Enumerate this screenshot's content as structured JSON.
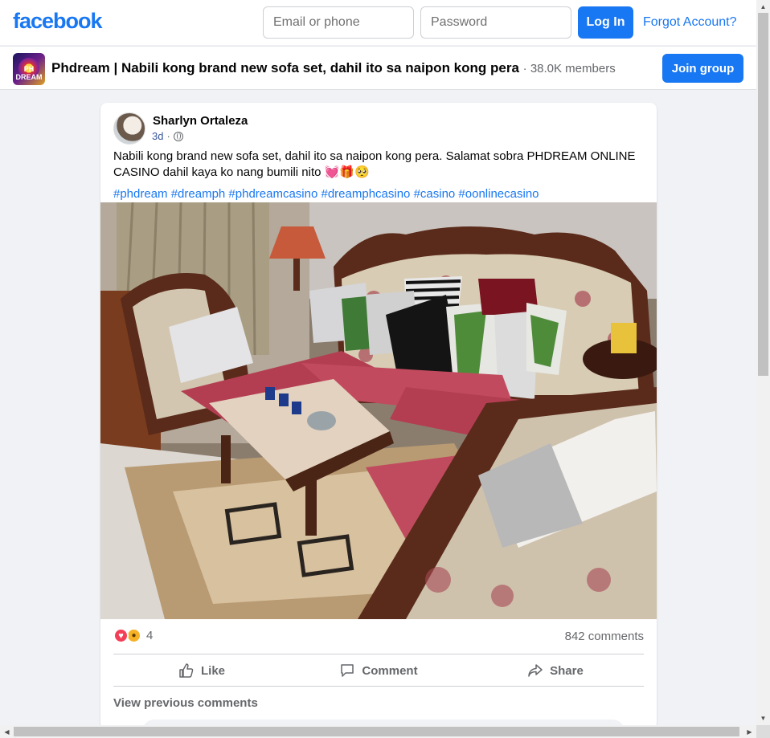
{
  "header": {
    "logo": "facebook",
    "email_placeholder": "Email or phone",
    "password_placeholder": "Password",
    "login_label": "Log In",
    "forgot_label": "Forgot Account?"
  },
  "group": {
    "icon_text": "PH DREAM",
    "title": "Phdream | Nabili kong brand new sofa set, dahil ito sa naipon kong pera",
    "members": "· 38.0K members",
    "join_label": "Join group"
  },
  "post": {
    "author": "Sharlyn Ortaleza",
    "time": "3d",
    "separator": "·",
    "text": "Nabili kong brand new sofa set, dahil ito sa naipon kong pera. Salamat sobra PHDREAM ONLINE CASINO dahil kaya ko nang bumili nito 💓🎁🥺",
    "hashtags": "#phdream #dreamph #phdreamcasino #dreamphcasino #casino #oonlinecasino",
    "reaction_count": "4",
    "comments_count": "842 comments",
    "actions": {
      "like": "Like",
      "comment": "Comment",
      "share": "Share"
    },
    "view_previous": "View previous comments"
  },
  "colors": {
    "brand": "#1877f2",
    "background": "#f0f2f5",
    "text_secondary": "#65676b"
  }
}
